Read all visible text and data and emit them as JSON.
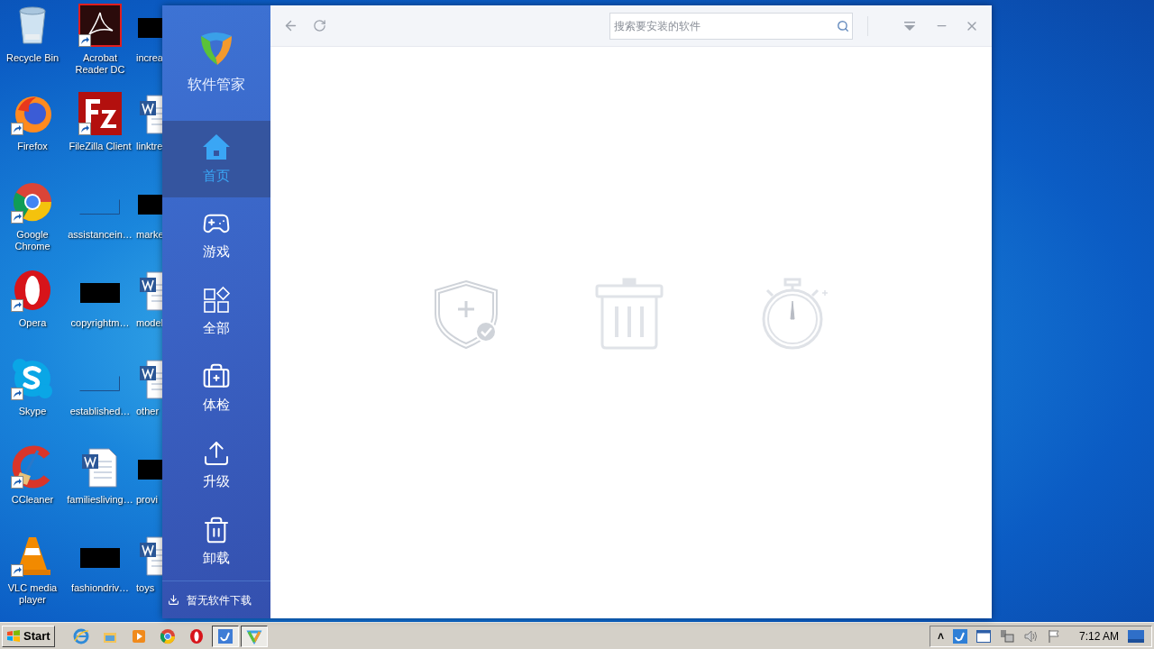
{
  "desktop": {
    "columns": [
      [
        {
          "label": "Recycle Bin",
          "kind": "recycle",
          "shortcut": false
        },
        {
          "label": "Firefox",
          "kind": "firefox",
          "shortcut": true
        },
        {
          "label": "Google Chrome",
          "kind": "chrome",
          "shortcut": true
        },
        {
          "label": "Opera",
          "kind": "opera",
          "shortcut": true
        },
        {
          "label": "Skype",
          "kind": "skype",
          "shortcut": true
        },
        {
          "label": "CCleaner",
          "kind": "ccleaner",
          "shortcut": true
        },
        {
          "label": "VLC media player",
          "kind": "vlc",
          "shortcut": true
        }
      ],
      [
        {
          "label": "Acrobat Reader DC",
          "kind": "acrobat",
          "shortcut": true
        },
        {
          "label": "FileZilla Client",
          "kind": "filezilla",
          "shortcut": true
        },
        {
          "label": "assistancein…",
          "kind": "blank",
          "shortcut": false
        },
        {
          "label": "copyrightm…",
          "kind": "black",
          "shortcut": false
        },
        {
          "label": "established…",
          "kind": "blank",
          "shortcut": false
        },
        {
          "label": "familiesliving…",
          "kind": "word",
          "shortcut": false
        },
        {
          "label": "fashiondriv…",
          "kind": "black",
          "shortcut": false
        }
      ],
      [
        {
          "label": "increa",
          "kind": "black",
          "shortcut": false
        },
        {
          "label": "linktre",
          "kind": "word",
          "shortcut": false
        },
        {
          "label": "marke",
          "kind": "black",
          "shortcut": false
        },
        {
          "label": "model",
          "kind": "word",
          "shortcut": false
        },
        {
          "label": "other",
          "kind": "word",
          "shortcut": false
        },
        {
          "label": "provi",
          "kind": "black",
          "shortcut": false
        },
        {
          "label": "toys",
          "kind": "word",
          "shortcut": false
        }
      ]
    ]
  },
  "app": {
    "title": "软件管家",
    "nav": [
      {
        "label": "首页",
        "kind": "home",
        "selected": true
      },
      {
        "label": "游戏",
        "kind": "game",
        "selected": false
      },
      {
        "label": "全部",
        "kind": "all",
        "selected": false
      },
      {
        "label": "体检",
        "kind": "checkup",
        "selected": false
      },
      {
        "label": "升级",
        "kind": "upgrade",
        "selected": false
      },
      {
        "label": "卸载",
        "kind": "uninstall",
        "selected": false
      }
    ],
    "downloads": "暂无软件下载",
    "search": {
      "placeholder": "搜索要安装的软件"
    }
  },
  "taskbar": {
    "start": "Start",
    "items": [
      {
        "kind": "ie",
        "active": false
      },
      {
        "kind": "folder",
        "active": false
      },
      {
        "kind": "media",
        "active": false
      },
      {
        "kind": "chrome",
        "active": false
      },
      {
        "kind": "opera",
        "active": false
      },
      {
        "kind": "tool",
        "active": true
      },
      {
        "kind": "shield",
        "active": true
      }
    ],
    "tray": {
      "expand": "˄",
      "clock": "7:12 AM"
    }
  }
}
